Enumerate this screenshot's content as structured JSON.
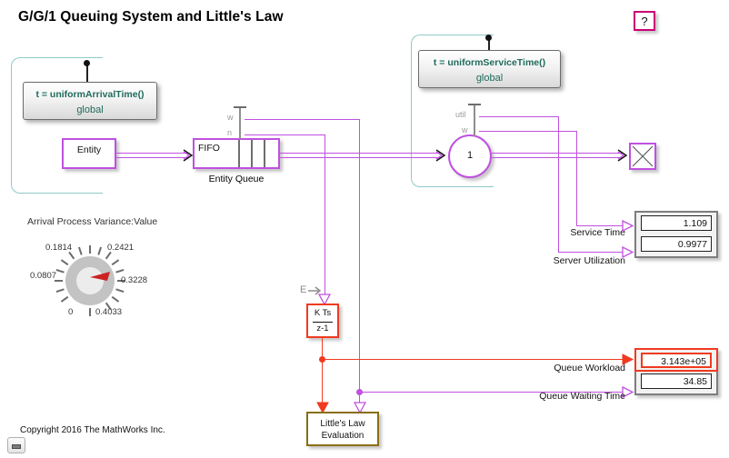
{
  "page": {
    "title": "G/G/1 Queuing System and Little's Law",
    "copyright": "Copyright 2016 The MathWorks Inc.",
    "help_label": "?",
    "accent_signal": "#c050e0",
    "accent_alert": "#f03a20",
    "accent_annotation": "#8fc9c6",
    "accent_subsystem": "#8a6d14",
    "accent_help_border": "#cc0077"
  },
  "blocks": {
    "entity_generator": {
      "label": "Entity"
    },
    "entity_queue": {
      "label": "FIFO",
      "caption": "Entity Queue",
      "ports": {
        "w": "w",
        "n": "n"
      }
    },
    "server": {
      "label": "1",
      "ports": {
        "util": "util",
        "w": "w"
      }
    },
    "terminator": {
      "icon": "entity-terminator-x-icon"
    },
    "arrival_function": {
      "line1": "t = uniformArrivalTime()",
      "line2": "global"
    },
    "service_function": {
      "line1": "t = uniformServiceTime()",
      "line2": "global"
    },
    "integrator": {
      "numerator": "K Ts",
      "denominator": "z-1",
      "input_port_label": "E"
    },
    "littles_law": {
      "line1": "Little's Law",
      "line2": "Evaluation"
    }
  },
  "displays": {
    "top_panel": [
      {
        "signal_label": "Service Time",
        "value": "1.109",
        "alert": false
      },
      {
        "signal_label": "Server Utilization",
        "value": "0.9977",
        "alert": false
      }
    ],
    "bottom_panel": [
      {
        "signal_label": "Queue Workload",
        "value": "3.143e+05",
        "alert": true
      },
      {
        "signal_label": "Queue Waiting Time",
        "value": "34.85",
        "alert": false
      }
    ]
  },
  "knob": {
    "title": "Arrival Process Variance:Value",
    "labels": [
      "0",
      "0.0807",
      "0.1814",
      "0.2421",
      "0.3228",
      "0.4033"
    ],
    "value": "0.3228",
    "needle_color": "#cc2222"
  },
  "controls": {
    "minimize_label": "minimize-icon"
  }
}
